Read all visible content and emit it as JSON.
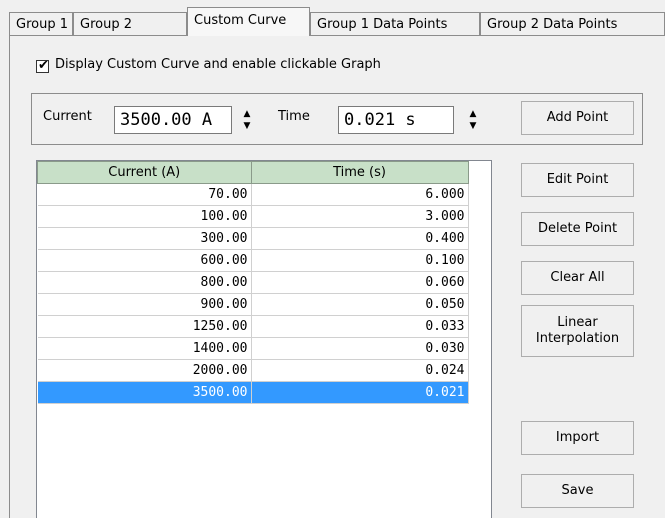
{
  "tabs": [
    {
      "label": "Group 1",
      "active": false
    },
    {
      "label": "Group 2",
      "active": false
    },
    {
      "label": "Custom Curve",
      "active": true
    },
    {
      "label": "Group 1 Data Points",
      "active": false
    },
    {
      "label": "Group 2 Data Points",
      "active": false
    }
  ],
  "display_checkbox": {
    "label": "Display Custom Curve and enable clickable Graph",
    "checked": true
  },
  "inputs": {
    "current_label": "Current",
    "current_value": "3500.00 A",
    "time_label": "Time",
    "time_value": "0.021 s",
    "add_point": "Add Point"
  },
  "grid": {
    "headers": [
      "Current (A)",
      "Time (s)"
    ],
    "rows": [
      [
        "70.00",
        "6.000"
      ],
      [
        "100.00",
        "3.000"
      ],
      [
        "300.00",
        "0.400"
      ],
      [
        "600.00",
        "0.100"
      ],
      [
        "800.00",
        "0.060"
      ],
      [
        "900.00",
        "0.050"
      ],
      [
        "1250.00",
        "0.033"
      ],
      [
        "1400.00",
        "0.030"
      ],
      [
        "2000.00",
        "0.024"
      ],
      [
        "3500.00",
        "0.021"
      ]
    ],
    "selected_row": 9
  },
  "buttons": {
    "edit_point": "Edit Point",
    "delete_point": "Delete Point",
    "clear_all": "Clear All",
    "linear_line1": "Linear",
    "linear_line2": "Interpolation",
    "import": "Import",
    "save": "Save"
  },
  "colors": {
    "header_bg": "#c8e0c8",
    "selection": "#3399ff"
  }
}
